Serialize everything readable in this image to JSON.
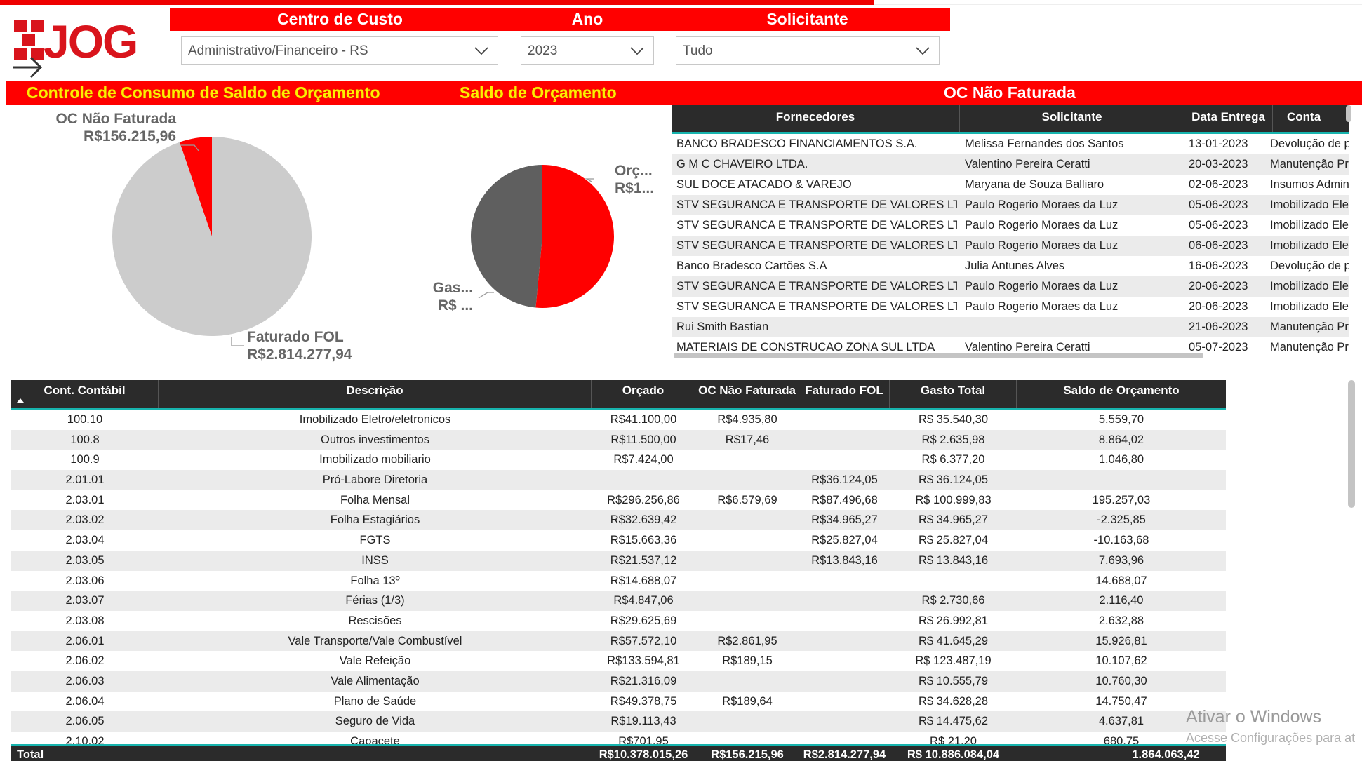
{
  "slicers": {
    "centro_custo": {
      "title": "Centro de Custo",
      "value": "Administrativo/Financeiro - RS"
    },
    "ano": {
      "title": "Ano",
      "value": "2023"
    },
    "solicitante": {
      "title": "Solicitante",
      "value": "Tudo"
    }
  },
  "titles": {
    "controle": "Controle de Consumo de Saldo de Orçamento",
    "saldo": "Saldo de Orçamento",
    "oc": "OC Não Faturada"
  },
  "pie1": {
    "label_oc": "OC Não Faturada",
    "value_oc": "R$156.215,96",
    "label_fol": "Faturado FOL",
    "value_fol": "R$2.814.277,94"
  },
  "pie2": {
    "label_orc": "Orç...",
    "value_orc": "R$1...",
    "label_gas": "Gas...",
    "value_gas": "R$ ..."
  },
  "chart_data": [
    {
      "type": "pie",
      "title": "Controle de Consumo de Saldo de Orçamento",
      "categories": [
        "OC Não Faturada",
        "Faturado FOL"
      ],
      "values": [
        156215.96,
        2814277.94
      ],
      "colors": [
        "#ff0000",
        "#cccccc"
      ]
    },
    {
      "type": "pie",
      "title": "Saldo de Orçamento",
      "categories": [
        "Orç...",
        "Gas..."
      ],
      "values": [
        51.5,
        48.5
      ],
      "colors": [
        "#ff0000",
        "#5f5f5f"
      ]
    }
  ],
  "oc_table": {
    "headers": [
      "Fornecedores",
      "Solicitante",
      "Data Entrega",
      "Conta"
    ],
    "rows": [
      [
        "BANCO BRADESCO FINANCIAMENTOS S.A.",
        "Melissa Fernandes dos Santos",
        "13-01-2023",
        "Devolução de p"
      ],
      [
        "G M C CHAVEIRO LTDA.",
        "Valentino Pereira Ceratti",
        "20-03-2023",
        "Manutenção Pr"
      ],
      [
        "SUL DOCE ATACADO & VAREJO",
        "Maryana de Souza Balliaro",
        "02-06-2023",
        "Insumos Admin"
      ],
      [
        "STV SEGURANCA E TRANSPORTE DE VALORES LT",
        "Paulo Rogerio Moraes da Luz",
        "05-06-2023",
        "Imobilizado Ele"
      ],
      [
        "STV SEGURANCA E TRANSPORTE DE VALORES LT",
        "Paulo Rogerio Moraes da Luz",
        "05-06-2023",
        "Imobilizado Ele"
      ],
      [
        "STV SEGURANCA E TRANSPORTE DE VALORES LT",
        "Paulo Rogerio Moraes da Luz",
        "06-06-2023",
        "Imobilizado Ele"
      ],
      [
        "Banco Bradesco Cartões S.A",
        "Julia Antunes Alves",
        "16-06-2023",
        "Devolução de p"
      ],
      [
        "STV SEGURANCA E TRANSPORTE DE VALORES LT",
        "Paulo Rogerio Moraes da Luz",
        "20-06-2023",
        "Imobilizado Ele"
      ],
      [
        "STV SEGURANCA E TRANSPORTE DE VALORES LT",
        "Paulo Rogerio Moraes da Luz",
        "20-06-2023",
        "Imobilizado Ele"
      ],
      [
        "Rui Smith Bastian",
        "",
        "21-06-2023",
        "Manutenção Pr"
      ],
      [
        "MATERIAIS DE CONSTRUCAO ZONA SUL LTDA",
        "Valentino Pereira Ceratti",
        "05-07-2023",
        "Manutenção Pr"
      ]
    ]
  },
  "main_table": {
    "headers": [
      "Cont. Contábil",
      "Descrição",
      "Orçado",
      "OC Não Faturada",
      "Faturado FOL",
      "Gasto Total",
      "Saldo de Orçamento"
    ],
    "rows": [
      [
        "100.10",
        "Imobilizado Eletro/eletronicos",
        "R$41.100,00",
        "R$4.935,80",
        "",
        "R$ 35.540,30",
        "5.559,70"
      ],
      [
        "100.8",
        "Outros investimentos",
        "R$11.500,00",
        "R$17,46",
        "",
        "R$ 2.635,98",
        "8.864,02"
      ],
      [
        "100.9",
        "Imobilizado mobiliario",
        "R$7.424,00",
        "",
        "",
        "R$ 6.377,20",
        "1.046,80"
      ],
      [
        "2.01.01",
        "Pró-Labore Diretoria",
        "",
        "",
        "R$36.124,05",
        "R$ 36.124,05",
        ""
      ],
      [
        "2.03.01",
        "Folha Mensal",
        "R$296.256,86",
        "R$6.579,69",
        "R$87.496,68",
        "R$ 100.999,83",
        "195.257,03"
      ],
      [
        "2.03.02",
        "Folha Estagiários",
        "R$32.639,42",
        "",
        "R$34.965,27",
        "R$ 34.965,27",
        "-2.325,85"
      ],
      [
        "2.03.04",
        "FGTS",
        "R$15.663,36",
        "",
        "R$25.827,04",
        "R$ 25.827,04",
        "-10.163,68"
      ],
      [
        "2.03.05",
        "INSS",
        "R$21.537,12",
        "",
        "R$13.843,16",
        "R$ 13.843,16",
        "7.693,96"
      ],
      [
        "2.03.06",
        "Folha 13º",
        "R$14.688,07",
        "",
        "",
        "",
        "14.688,07"
      ],
      [
        "2.03.07",
        "Férias (1/3)",
        "R$4.847,06",
        "",
        "",
        "R$ 2.730,66",
        "2.116,40"
      ],
      [
        "2.03.08",
        "Rescisões",
        "R$29.625,69",
        "",
        "",
        "R$ 26.992,81",
        "2.632,88"
      ],
      [
        "2.06.01",
        "Vale Transporte/Vale Combustível",
        "R$57.572,10",
        "R$2.861,95",
        "",
        "R$ 41.645,29",
        "15.926,81"
      ],
      [
        "2.06.02",
        "Vale Refeição",
        "R$133.594,81",
        "R$189,15",
        "",
        "R$ 123.487,19",
        "10.107,62"
      ],
      [
        "2.06.03",
        "Vale Alimentação",
        "R$21.316,09",
        "",
        "",
        "R$ 10.555,79",
        "10.760,30"
      ],
      [
        "2.06.04",
        "Plano de Saúde",
        "R$49.378,75",
        "R$189,64",
        "",
        "R$ 34.628,28",
        "14.750,47"
      ],
      [
        "2.06.05",
        "Seguro de Vida",
        "R$19.113,43",
        "",
        "",
        "R$ 14.475,62",
        "4.637,81"
      ],
      [
        "2.10.02",
        "Capacete",
        "R$701,95",
        "",
        "",
        "R$ 21,20",
        "680,75"
      ]
    ],
    "total": [
      "Total",
      "",
      "R$10.378.015,26",
      "R$156.215,96",
      "R$2.814.277,94",
      "R$ 10.886.084,04",
      "1.864.063,42"
    ]
  },
  "watermark": {
    "line1": "Ativar o Windows",
    "line2": "Acesse Configurações para at"
  }
}
